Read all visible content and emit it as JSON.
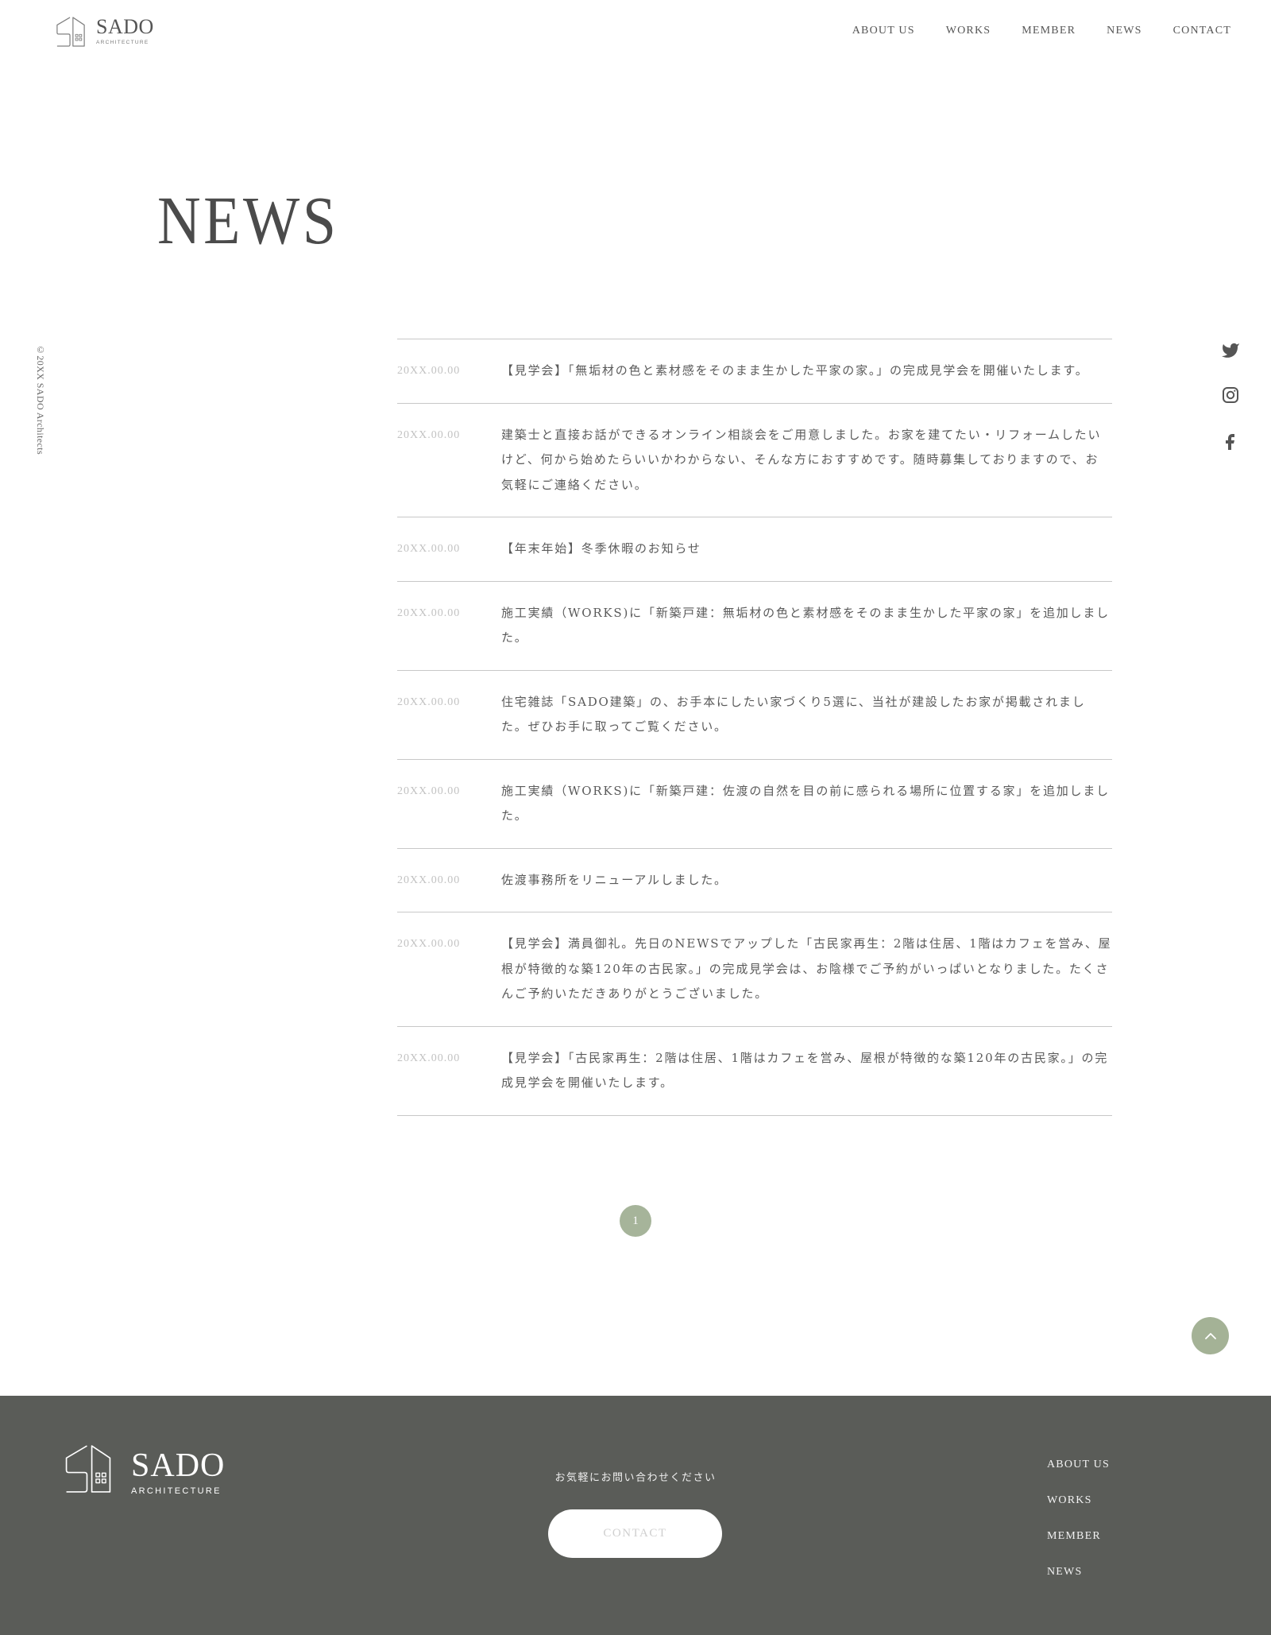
{
  "header": {
    "logo": {
      "name": "SADO",
      "sub": "ARCHITECTURE",
      "icon": "house-logo-icon"
    },
    "nav": [
      "ABOUT US",
      "WORKS",
      "MEMBER",
      "NEWS",
      "CONTACT"
    ]
  },
  "page_title": "NEWS",
  "side_copyright": "©20XX SADO Architects",
  "social_icons": [
    "twitter-icon",
    "instagram-icon",
    "facebook-icon"
  ],
  "news": [
    {
      "date": "20XX.00.00",
      "text": "【見学会】「無垢材の色と素材感をそのまま生かした平家の家。」の完成見学会を開催いたします。"
    },
    {
      "date": "20XX.00.00",
      "text": "建築士と直接お話ができるオンライン相談会をご用意しました。お家を建てたい・リフォームしたいけど、何から始めたらいいかわからない、そんな方におすすめです。随時募集しておりますので、お気軽にご連絡ください。"
    },
    {
      "date": "20XX.00.00",
      "text": "【年末年始】冬季休暇のお知らせ"
    },
    {
      "date": "20XX.00.00",
      "text": "施工実績（WORKS)に「新築戸建：無垢材の色と素材感をそのまま生かした平家の家」を追加しました。"
    },
    {
      "date": "20XX.00.00",
      "text": "住宅雑誌「SADO建築」の、お手本にしたい家づくり5選に、当社が建設したお家が掲載されました。ぜひお手に取ってご覧ください。"
    },
    {
      "date": "20XX.00.00",
      "text": "施工実績（WORKS)に「新築戸建：佐渡の自然を目の前に感られる場所に位置する家」を追加しました。"
    },
    {
      "date": "20XX.00.00",
      "text": "佐渡事務所をリニューアルしました。"
    },
    {
      "date": "20XX.00.00",
      "text": "【見学会】満員御礼。先日のNEWSでアップした「古民家再生：2階は住居、1階はカフェを営み、屋根が特徴的な築120年の古民家。」の完成見学会は、お陰様でご予約がいっぱいとなりました。たくさんご予約いただきありがとうございました。"
    },
    {
      "date": "20XX.00.00",
      "text": "【見学会】「古民家再生：2階は住居、1階はカフェを営み、屋根が特徴的な築120年の古民家。」の完成見学会を開催いたします。"
    }
  ],
  "pagination": {
    "current": "1"
  },
  "back_to_top": {
    "icon": "chevron-up-icon"
  },
  "footer": {
    "logo": {
      "name": "SADO",
      "sub": "ARCHITECTURE",
      "icon": "house-logo-icon"
    },
    "contact_lead": "お気軽にお問い合わせください",
    "contact_button": "CONTACT",
    "nav": [
      "ABOUT US",
      "WORKS",
      "MEMBER",
      "NEWS"
    ]
  },
  "colors": {
    "accent": "#a6b49a",
    "footer_bg": "#5a5c58",
    "text": "#555555",
    "date": "#c2c2c2",
    "rule": "#c8c8c8"
  }
}
